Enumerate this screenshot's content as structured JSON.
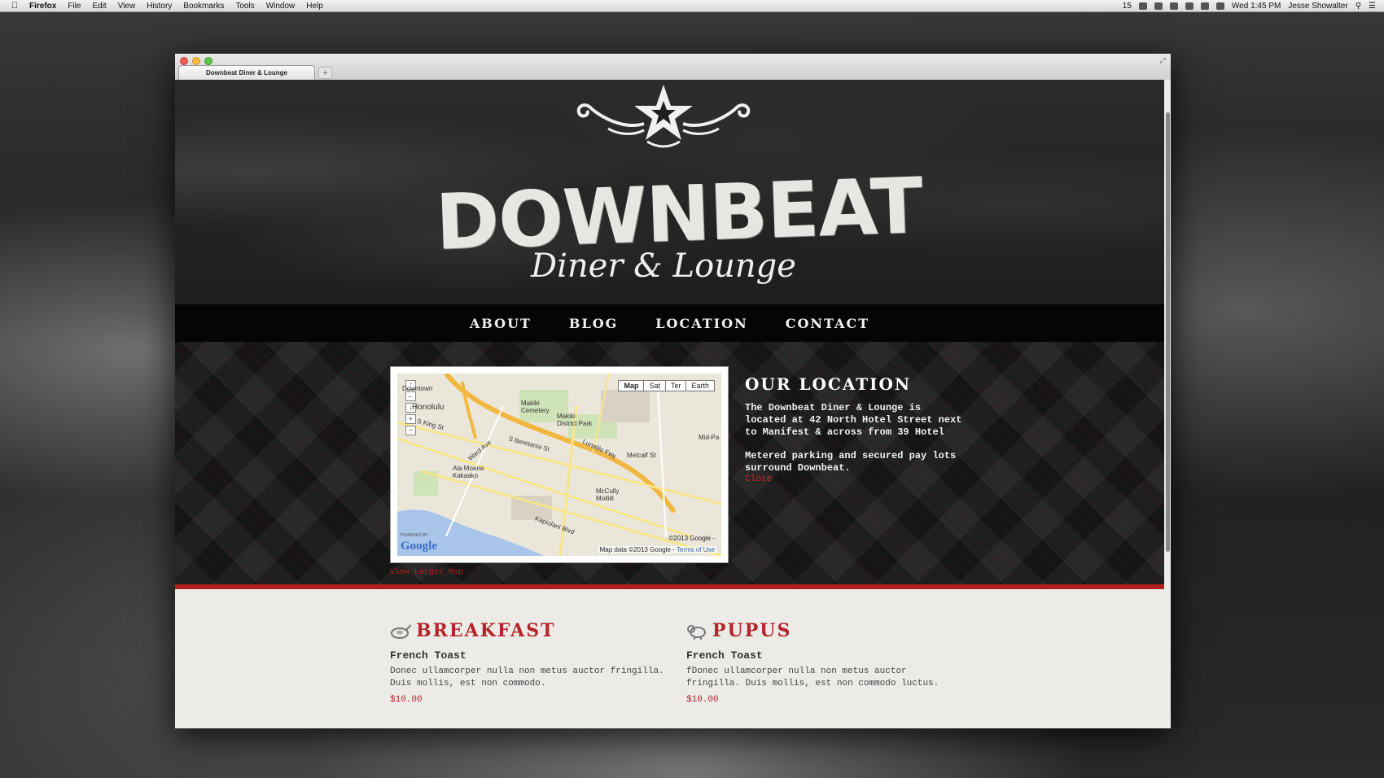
{
  "menubar": {
    "app": "Firefox",
    "items": [
      "File",
      "Edit",
      "View",
      "History",
      "Bookmarks",
      "Tools",
      "Window",
      "Help"
    ],
    "battery_count": "15",
    "clock": "Wed 1:45 PM",
    "user": "Jesse Showalter"
  },
  "browser": {
    "tab_title": "Downbeat Diner & Lounge",
    "new_tab": "+"
  },
  "header": {
    "logo_word": "DOWNBEAT",
    "logo_sub": "Diner & Lounge"
  },
  "nav": [
    "ABOUT",
    "BLOG",
    "LOCATION",
    "CONTACT"
  ],
  "map": {
    "types": [
      "Map",
      "Sat",
      "Ter",
      "Earth"
    ],
    "active_type": "Map",
    "labels": {
      "downtown": "Downtown",
      "honolulu": "Honolulu",
      "makiki_cemetery": "Makiki Cemetery",
      "makiki_district_park": "Makiki District Park",
      "ala_moana": "Ala Moana Kakaako",
      "mccully": "McCully Moiliili",
      "lunalilo": "Lunalilo Fwy",
      "s_king": "S King St",
      "s_beretania": "S Beretania St",
      "kapiolani": "Kapiolani Blvd",
      "ward": "Ward Ave",
      "metcalf": "Metcalf St",
      "mid_pacific": "Mid-Pa"
    },
    "copyright": "©2013 Google -",
    "map_data": "Map data ©2013 Google -",
    "terms": "Terms of Use",
    "powered_by": "POWERED BY",
    "google_logo": "Google",
    "view_larger": "View Larger Map"
  },
  "location": {
    "title": "OUR LOCATION",
    "p1": "The Downbeat Diner & Lounge is located at 42 North Hotel Street next to Manifest & across from 39 Hotel",
    "p2": "Metered parking and secured pay lots surround Downbeat.",
    "close": "Close"
  },
  "menu": {
    "breakfast": {
      "title": "BREAKFAST",
      "item_name": "French Toast",
      "item_desc": "Donec ullamcorper nulla non metus auctor fringilla. Duis mollis, est non commodo.",
      "item_price": "$10.00"
    },
    "pupus": {
      "title": "PUPUS",
      "item_name": "French Toast",
      "item_desc": "fDonec ullamcorper nulla non metus auctor fringilla. Duis mollis, est non commodo luctus.",
      "item_price": "$10.00"
    }
  },
  "colors": {
    "accent_red": "#b5262a",
    "nav_bg": "#050505",
    "menu_bg": "#ecebe8"
  }
}
